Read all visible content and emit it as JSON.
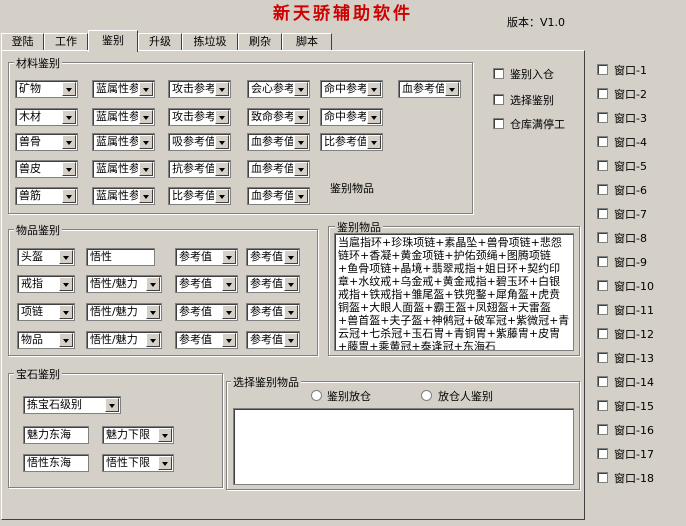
{
  "app": {
    "title": "新天骄辅助软件",
    "version": "版本：V1.0"
  },
  "tabs": [
    "登陆",
    "工作",
    "鉴别",
    "升级",
    "拣垃圾",
    "刷杂",
    "脚本"
  ],
  "material": {
    "legend": "材料鉴别",
    "rows": [
      [
        "矿物",
        "蓝属性参",
        "攻击参考",
        "会心参考",
        "命中参考",
        "血参考值"
      ],
      [
        "木材",
        "蓝属性参",
        "攻击参考",
        "致命参考",
        "命中参考"
      ],
      [
        "兽骨",
        "蓝属性参",
        "吸参考值",
        "血参考值",
        "比参考值"
      ],
      [
        "兽皮",
        "蓝属性参",
        "抗参考值",
        "血参考值"
      ],
      [
        "兽筋",
        "蓝属性参",
        "比参考值",
        "血参考值"
      ]
    ],
    "items_label": "鉴别物品"
  },
  "options": {
    "identify_in": "鉴别入仓",
    "select_identify": "选择鉴别",
    "stop_when_full": "仓库满停工"
  },
  "windows": [
    "窗口-1",
    "窗口-2",
    "窗口-3",
    "窗口-4",
    "窗口-5",
    "窗口-6",
    "窗口-7",
    "窗口-8",
    "窗口-9",
    "窗口-10",
    "窗口-11",
    "窗口-12",
    "窗口-13",
    "窗口-14",
    "窗口-15",
    "窗口-16",
    "窗口-17",
    "窗口-18"
  ],
  "item_ident": {
    "legend": "物品鉴别",
    "rows": [
      {
        "type": "头盔",
        "attr": "悟性",
        "attr_is_combo": false,
        "v1": "参考值",
        "v2": "参考值"
      },
      {
        "type": "戒指",
        "attr": "悟性/魅力",
        "attr_is_combo": true,
        "v1": "参考值",
        "v2": "参考值"
      },
      {
        "type": "项链",
        "attr": "悟性/魅力",
        "attr_is_combo": true,
        "v1": "参考值",
        "v2": "参考值"
      },
      {
        "type": "物品",
        "attr": "悟性/魅力",
        "attr_is_combo": true,
        "v1": "参考值",
        "v2": "参考值"
      }
    ]
  },
  "ident_items": {
    "legend": "鉴别物品",
    "text": "当扈指环+珍珠项链+素晶坠+兽骨项链+悲怨链环+香凝+黄金项链+护佑颈绳+图腾项链+鱼骨项链+晶境+翡翠戒指+姐日环+契约印章+水纹戒+乌金戒+黄金戒指+碧玉环+白银戒指+铁戒指+雏尾盔+铁兜鍪+犀角盔+虎贲铜盔+大眼人面盔+霸王盔+凤翅盔+天雷盔+兽首盔+夫子盔+神鸺冠+破军冠+紫微冠+青云冠+七杀冠+玉石冑+青铜冑+紫藤冑+皮冑+藤冑+乘黄冠+泰逢冠+东海石"
  },
  "gem": {
    "legend": "宝石鉴别",
    "level_select": "拣宝石级别",
    "rows": [
      {
        "name": "魅力东海",
        "limit": "魅力下限"
      },
      {
        "name": "悟性东海",
        "limit": "悟性下限"
      }
    ]
  },
  "select_items": {
    "legend": "选择鉴别物品",
    "radio1": "鉴别放仓",
    "radio2": "放仓人鉴别"
  }
}
